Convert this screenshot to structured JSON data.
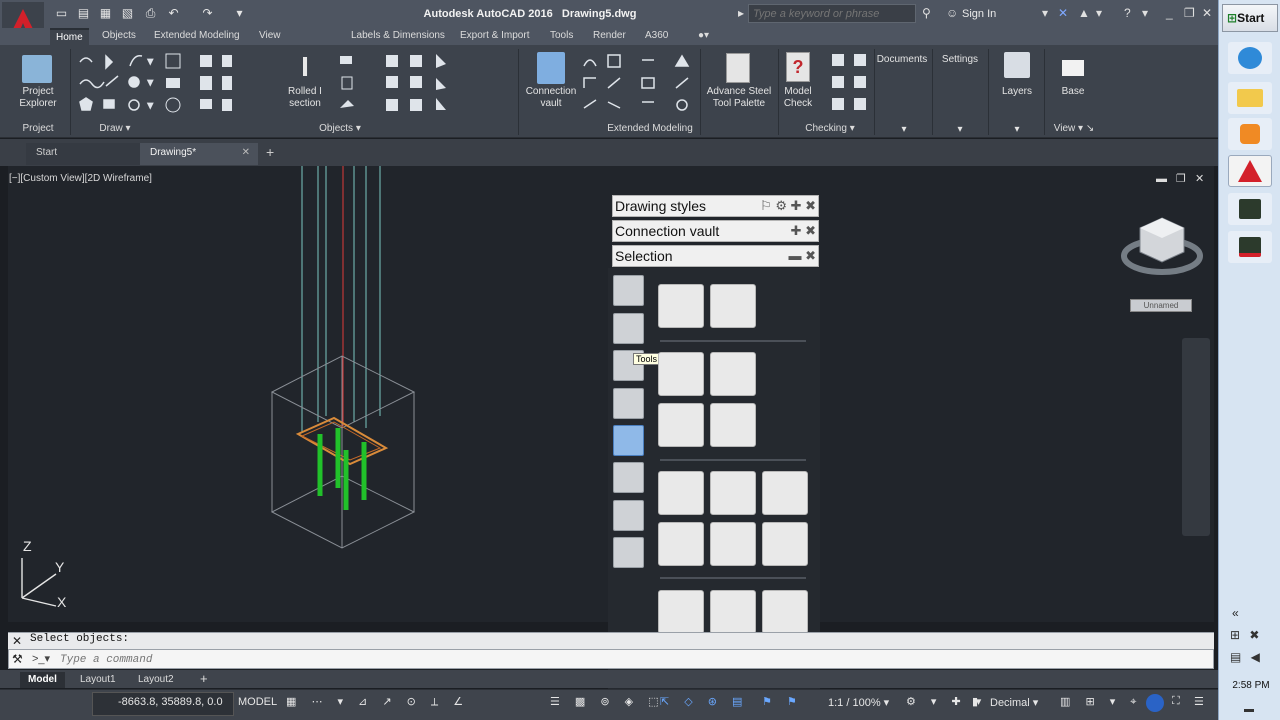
{
  "title": {
    "app_name": "Autodesk AutoCAD 2016",
    "document": "Drawing5.dwg",
    "search_placeholder": "Type a keyword or phrase",
    "sign_in": "Sign In"
  },
  "ribbon_tabs": [
    "Home",
    "Objects",
    "Extended Modeling",
    "View",
    "Labels & Dimensions",
    "Export & Import",
    "Tools",
    "Render",
    "A360"
  ],
  "ribbon": {
    "project_explorer": "Project Explorer",
    "rolled_i_section": "Rolled I section",
    "connection_vault": "Connection vault",
    "advance_steel_tool_palette": "Advance Steel Tool Palette",
    "model_check": "Model Check",
    "documents": "Documents",
    "settings": "Settings",
    "layers": "Layers",
    "base": "Base",
    "panel_titles": {
      "project": "Project",
      "draw": "Draw",
      "objects": "Objects",
      "extended_modeling": "Extended Modeling",
      "checking": "Checking",
      "view": "View"
    }
  },
  "file_tabs": [
    "Start",
    "Drawing5*"
  ],
  "viewport": {
    "label": "[−][Custom View][2D Wireframe]",
    "view_cube_face": "Unnamed",
    "ucs": {
      "z": "Z",
      "y": "Y",
      "x": "X"
    }
  },
  "palette": {
    "headers": [
      "Drawing styles",
      "Connection vault",
      "Selection"
    ],
    "tooltip": "Tools"
  },
  "command": {
    "history": "Select objects:",
    "placeholder": "Type a command"
  },
  "layout_tabs": [
    "Model",
    "Layout1",
    "Layout2"
  ],
  "status": {
    "coords": "-8663.8, 35889.8, 0.0",
    "space": "MODEL",
    "scale": "1:1 / 100%",
    "units": "Decimal"
  },
  "taskbar": {
    "start": "Start",
    "clock": "2:58 PM"
  }
}
